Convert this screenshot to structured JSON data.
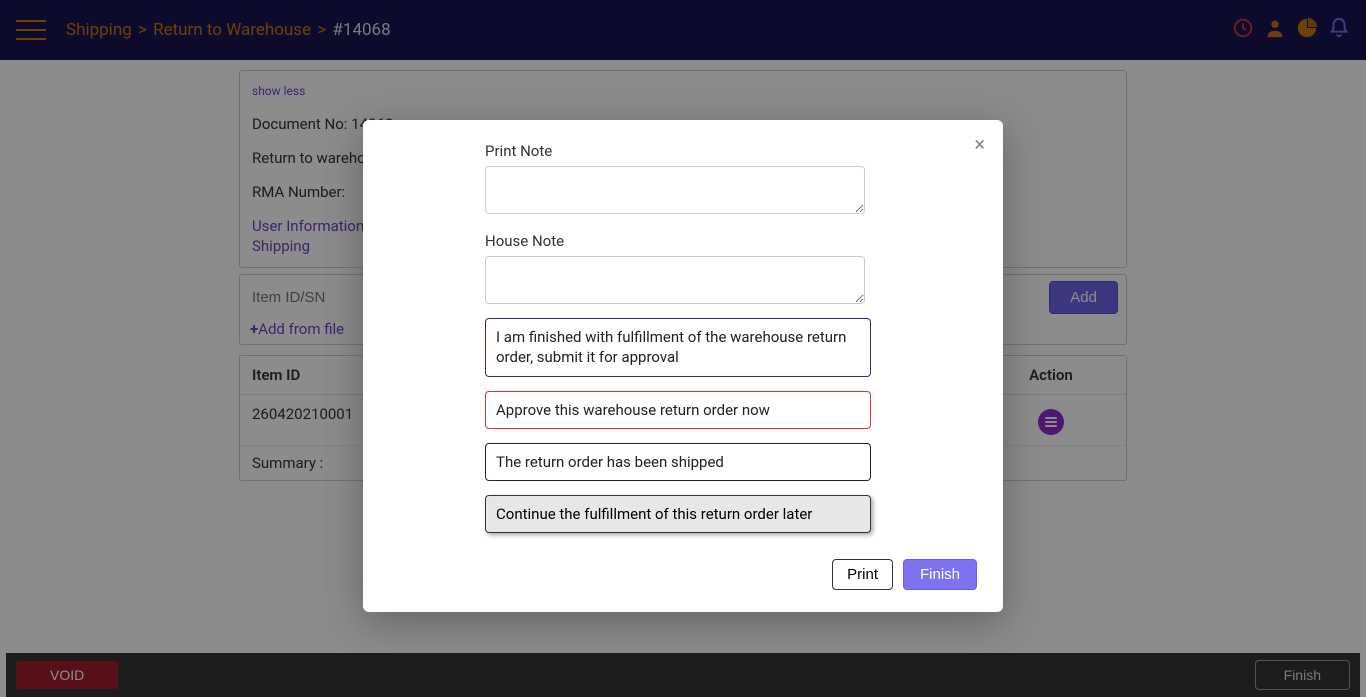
{
  "header": {
    "breadcrumb": {
      "shipping": "Shipping",
      "return": "Return to Warehouse",
      "id": "#14068"
    }
  },
  "panel": {
    "show_less": "show less",
    "doc_no": "Document No: 14068",
    "return_line": "Return to warehouse:",
    "rma_line": "RMA Number:",
    "user_info": "User Information",
    "shipping": "Shipping"
  },
  "entry": {
    "placeholder": "Item ID/SN",
    "add": "Add",
    "add_from_file": "Add from file"
  },
  "table": {
    "col_item": "Item ID",
    "col_action": "Action",
    "rows": [
      {
        "item_id": "260420210001"
      }
    ],
    "summary": "Summary :"
  },
  "footer": {
    "void": "VOID",
    "finish": "Finish"
  },
  "modal": {
    "print_note_label": "Print Note",
    "house_note_label": "House Note",
    "opt_submit": "I am finished with fulfillment of the warehouse return order, submit it for approval",
    "opt_approve": "Approve this warehouse return order now",
    "opt_shipped": "The return order has been shipped",
    "opt_later": "Continue the fulfillment of this return order later",
    "print": "Print",
    "finish": "Finish"
  }
}
